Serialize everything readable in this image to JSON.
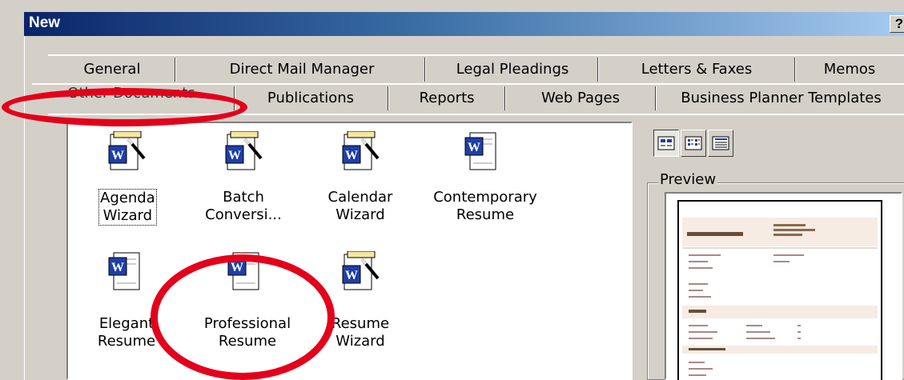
{
  "window": {
    "title": "New",
    "help_label": "?"
  },
  "tabs": {
    "row1": [
      "General",
      "Direct Mail Manager",
      "Legal Pleadings",
      "Letters & Faxes",
      "Memos"
    ],
    "row2": [
      "Other Documents",
      "Publications",
      "Reports",
      "Web Pages",
      "Business Planner Templates"
    ],
    "active": "Other Documents"
  },
  "templates": [
    {
      "line1": "Agenda",
      "line2": "Wizard",
      "icon": "word-wizard-icon"
    },
    {
      "line1": "Batch",
      "line2": "Conversi...",
      "icon": "word-wizard-icon"
    },
    {
      "line1": "Calendar",
      "line2": "Wizard",
      "icon": "word-wizard-icon"
    },
    {
      "line1": "Contemporary",
      "line2": "Resume",
      "icon": "word-document-icon"
    },
    {
      "line1": "Elegant",
      "line2": "Resume",
      "icon": "word-document-icon"
    },
    {
      "line1": "Professional",
      "line2": "Resume",
      "icon": "word-document-icon"
    },
    {
      "line1": "Resume",
      "line2": "Wizard",
      "icon": "word-wizard-icon"
    }
  ],
  "view_buttons": [
    "large-icons-view",
    "list-view",
    "details-view"
  ],
  "preview": {
    "legend": "Preview"
  },
  "colors": {
    "annotation": "#e3001b",
    "titlebar_start": "#0a246a",
    "word_blue": "#1f3fa8"
  }
}
